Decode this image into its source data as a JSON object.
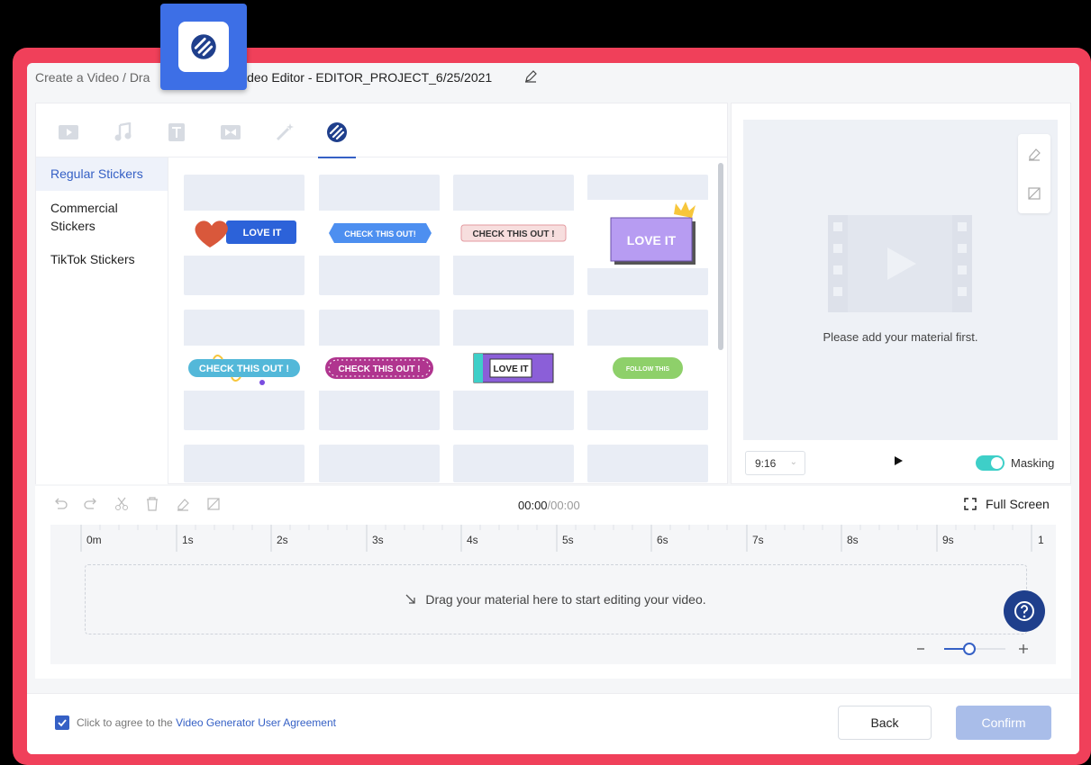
{
  "header": {
    "crumb_1": "Create a Video",
    "separator": "/",
    "crumb_2_partial": "Dra",
    "title": "ideo Editor - EDITOR_PROJECT_6/25/2021"
  },
  "tabs": [
    {
      "icon": "video-icon"
    },
    {
      "icon": "music-icon"
    },
    {
      "icon": "text-icon"
    },
    {
      "icon": "transition-icon"
    },
    {
      "icon": "effects-icon"
    },
    {
      "icon": "sticker-icon",
      "active": true
    }
  ],
  "categories": [
    "Regular Stickers",
    "Commercial Stickers",
    "TikTok Stickers"
  ],
  "stickers": [
    {
      "text": "LOVE IT",
      "bg": "#2c62d9",
      "fg": "#ffffff"
    },
    {
      "text": "CHECK THIS OUT!",
      "bg": "#4d8ff0",
      "fg": "#ffffff"
    },
    {
      "text": "CHECK THIS OUT !",
      "bg": "#f7dede",
      "fg": "#333333"
    },
    {
      "text": "LOVE IT",
      "bg": "#b79cf2",
      "fg": "#ffffff"
    },
    {
      "text": "CHECK THIS OUT !",
      "bg": "#53b8d9",
      "fg": "#ffffff"
    },
    {
      "text": "CHECK THIS OUT !",
      "bg": "#b0358f",
      "fg": "#ffffff"
    },
    {
      "text": "LOVE IT",
      "bg": "#8b5fd8",
      "fg": "#222222"
    },
    {
      "text": "FOLLOW THIS",
      "bg": "#8ed06a",
      "fg": "#ffffff"
    }
  ],
  "preview": {
    "message": "Please add your material first.",
    "ratio": "9:16",
    "masking_label": "Masking"
  },
  "timeline": {
    "time_current": "00:00",
    "time_total": "/00:00",
    "fullscreen_label": "Full Screen",
    "ticks": [
      "0m",
      "1s",
      "2s",
      "3s",
      "4s",
      "5s",
      "6s",
      "7s",
      "8s",
      "9s",
      "1"
    ],
    "drop_text": "Drag your material here to start editing your video."
  },
  "footer": {
    "agree_text": "Click to agree to the",
    "agree_link": "Video Generator User Agreement",
    "back_label": "Back",
    "confirm_label": "Confirm"
  }
}
